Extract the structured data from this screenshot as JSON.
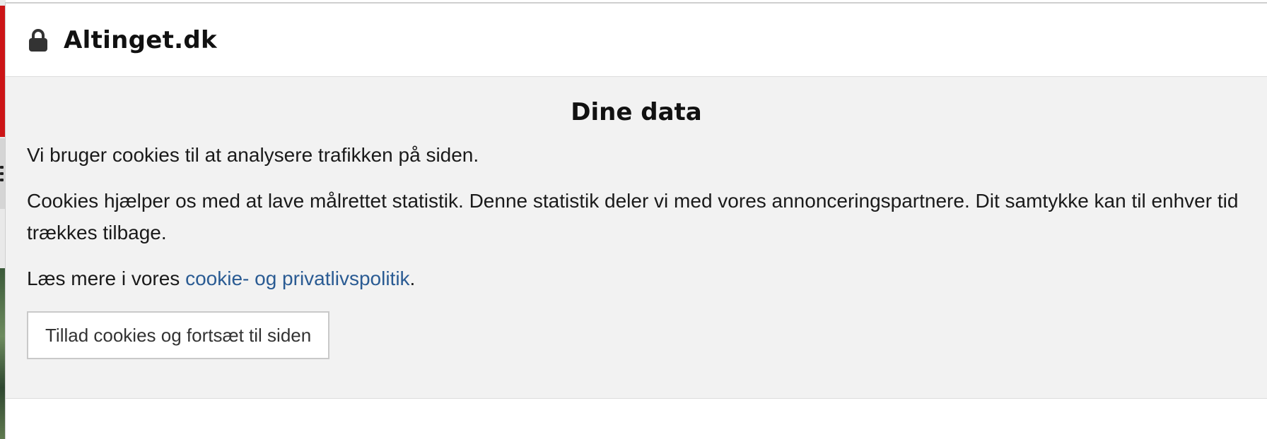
{
  "header": {
    "icon": "lock-icon",
    "site_name": "Altinget.dk"
  },
  "dialog": {
    "title": "Dine data",
    "paragraph_1": "Vi bruger cookies til at analysere trafikken på siden.",
    "paragraph_2": "Cookies hjælper os med at lave målrettet statistik. Denne statistik deler vi med vores annonceringspartnere. Dit samtykke kan til enhver tid trækkes tilbage.",
    "read_more_prefix": "Læs mere i vores ",
    "policy_link": "cookie- og privatlivspolitik",
    "read_more_suffix": ".",
    "accept_button": "Tillad cookies og fortsæt til siden"
  },
  "colors": {
    "link": "#2a5b93",
    "body_background": "#f2f2f2",
    "brand_red": "#cc1517"
  }
}
